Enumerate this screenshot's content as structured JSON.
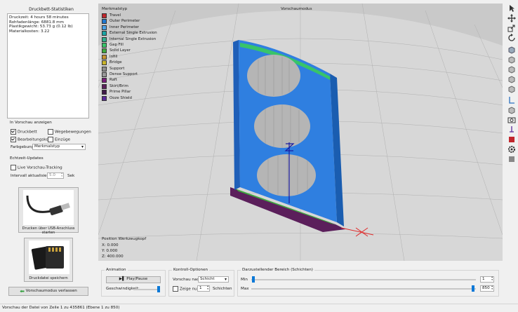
{
  "left_panel": {
    "stats_title": "Druckbett-Statistiken",
    "stats_lines": [
      "Druckzeit: 4 hours 58 minutes",
      "Rohfadenlänge: 6881.8 mm",
      "Plastikgewicht: 53.73 g (0.12 lb)",
      "Materialkosten: 3.22"
    ],
    "preview_group": "In Vorschau anzeigen",
    "checkboxes": [
      {
        "label": "Druckbett",
        "checked": true
      },
      {
        "label": "Wegebewegungen",
        "checked": false
      },
      {
        "label": "Bearbeitungskopf",
        "checked": true
      },
      {
        "label": "Einzüge",
        "checked": false
      }
    ],
    "color_label": "Farbgebung",
    "color_value": "Merkmalstyp",
    "realtime_group": "Echtzeit-Updates",
    "live_tracking_label": "Live Vorschau-Tracking",
    "live_tracking_checked": false,
    "interval_label": "Intervall aktualisieren",
    "interval_value": "5.0",
    "interval_unit": "Sek",
    "usb_button": "Drucken über USB-Anschluss starten",
    "save_button": "Druckdatei speichern",
    "leave_button": "Vorschaumodus verlassen"
  },
  "viewport": {
    "mode_title": "Vorschaumodus",
    "legend_title": "Merkmalstyp",
    "legend": [
      {
        "label": "Travel",
        "color": "#c1272d"
      },
      {
        "label": "Outer Perimeter",
        "color": "#1f77d0"
      },
      {
        "label": "Inner Perimeter",
        "color": "#4aa0e6"
      },
      {
        "label": "External Single Extrusion",
        "color": "#1aa5a5"
      },
      {
        "label": "Internal Single Extrusion",
        "color": "#2fae8c"
      },
      {
        "label": "Gap Fill",
        "color": "#38c46a"
      },
      {
        "label": "Solid Layer",
        "color": "#3fa83f"
      },
      {
        "label": "Infill",
        "color": "#c69233"
      },
      {
        "label": "Bridge",
        "color": "#c9b42a"
      },
      {
        "label": "Support",
        "color": "#8e8e8e"
      },
      {
        "label": "Dense Support",
        "color": "#9a9a9a"
      },
      {
        "label": "Raft",
        "color": "#7a1c7a"
      },
      {
        "label": "Skirt/Brim",
        "color": "#5b1f5b"
      },
      {
        "label": "Prime Pillar",
        "color": "#401a4a"
      },
      {
        "label": "Ooze Shield",
        "color": "#5a2a9a"
      }
    ],
    "position_title": "Position Werkzeugkopf",
    "position": [
      "X: 0.000",
      "Y: 0.000",
      "Z: 400.000"
    ]
  },
  "bottom": {
    "animation_group": "Animation",
    "play_label": "Play/Pause",
    "speed_label": "Geschwindigkeit:",
    "speed_level": 0.95,
    "control_group": "Kontroll-Optionen",
    "preview_by_label": "Vorschau nach",
    "preview_by_value": "Schicht",
    "show_only_label": "Zeige nur",
    "show_only_value": "1",
    "layers_label": "Schichten",
    "range_group": "Darzustellender Bereich (Schichten)",
    "min_label": "Min",
    "max_label": "Max",
    "min_value": "1",
    "max_value": "850"
  },
  "status_bar": "Vorschau der Datei von Zeile 1 zu 435861 (Ebene 1 zu 850)",
  "toolbar_icons": [
    "select-cursor-icon",
    "move-icon",
    "scale-icon",
    "rotate-icon",
    "view-iso-icon",
    "view-front-icon",
    "view-back-icon",
    "view-left-icon",
    "view-right-icon",
    "view-top-icon",
    "view-bottom-icon",
    "camera-icon",
    "nozzle-icon",
    "material-icon",
    "settings-gear-icon",
    "filament-icon"
  ]
}
